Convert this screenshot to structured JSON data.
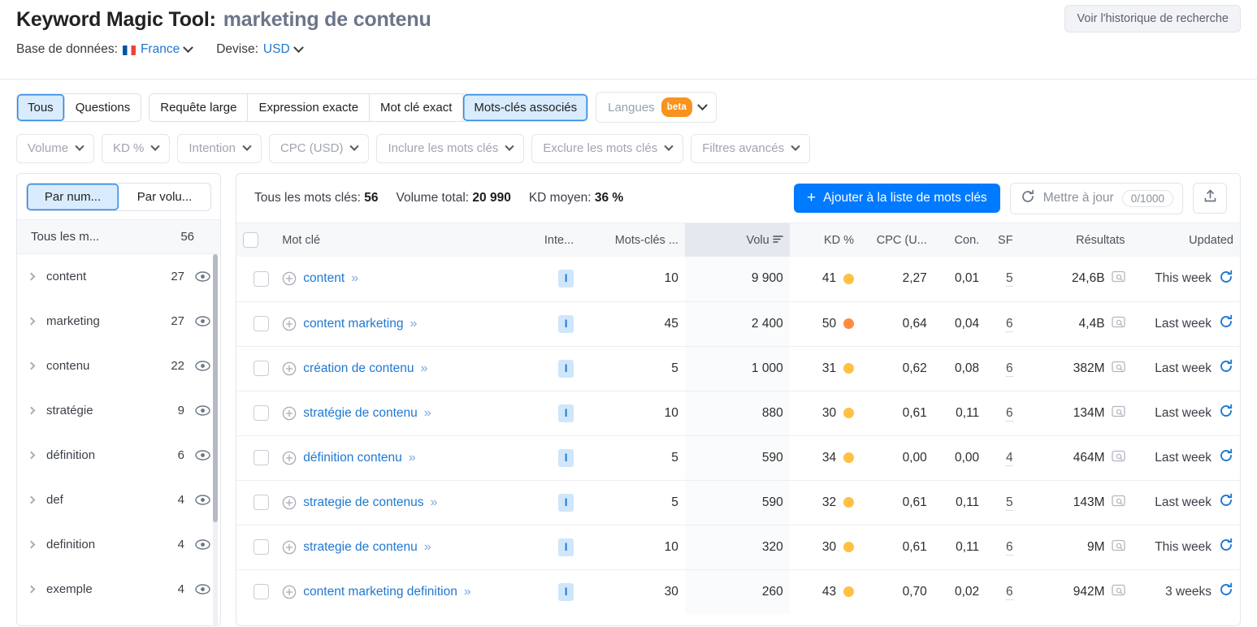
{
  "header": {
    "tool_title": "Keyword Magic Tool:",
    "query": "marketing de contenu",
    "database_label": "Base de données:",
    "database_value": "France",
    "currency_label": "Devise:",
    "currency_value": "USD",
    "history_button": "Voir l'historique de recherche"
  },
  "tabs": [
    {
      "label": "Tous",
      "active": true
    },
    {
      "label": "Questions",
      "active": false
    },
    {
      "label": "Requête large",
      "active": false
    },
    {
      "label": "Expression exacte",
      "active": false
    },
    {
      "label": "Mot clé exact",
      "active": false
    },
    {
      "label": "Mots-clés associés",
      "active": true
    }
  ],
  "languages": {
    "label": "Langues",
    "badge": "beta"
  },
  "filters": [
    "Volume",
    "KD %",
    "Intention",
    "CPC (USD)",
    "Inclure les mots clés",
    "Exclure les mots clés",
    "Filtres avancés"
  ],
  "sidebar": {
    "toggle": [
      {
        "label": "Par num...",
        "active": true
      },
      {
        "label": "Par volu...",
        "active": false
      }
    ],
    "all_label": "Tous les m...",
    "all_count": "56",
    "items": [
      {
        "label": "content",
        "count": "27"
      },
      {
        "label": "marketing",
        "count": "27"
      },
      {
        "label": "contenu",
        "count": "22"
      },
      {
        "label": "stratégie",
        "count": "9"
      },
      {
        "label": "définition",
        "count": "6"
      },
      {
        "label": "def",
        "count": "4"
      },
      {
        "label": "definition",
        "count": "4"
      },
      {
        "label": "exemple",
        "count": "4"
      }
    ]
  },
  "summary": {
    "total_keywords_label": "Tous les mots clés:",
    "total_keywords_value": "56",
    "total_volume_label": "Volume total:",
    "total_volume_value": "20 990",
    "avg_kd_label": "KD moyen:",
    "avg_kd_value": "36 %",
    "add_button": "Ajouter à la liste de mots clés",
    "update_button": "Mettre à jour",
    "update_counter": "0/1000"
  },
  "table": {
    "columns": [
      "Mot clé",
      "Inte...",
      "Mots-clés ...",
      "Volu",
      "KD %",
      "CPC (U...",
      "Con.",
      "SF",
      "Résultats",
      "Updated"
    ],
    "rows": [
      {
        "keyword": "content",
        "intent": "I",
        "related": "10",
        "volume": "9 900",
        "kd": "41",
        "kd_color": "#ffc043",
        "cpc": "2,27",
        "com": "0,01",
        "sf": "5",
        "results": "24,6B",
        "updated": "This week"
      },
      {
        "keyword": "content marketing",
        "intent": "I",
        "related": "45",
        "volume": "2 400",
        "kd": "50",
        "kd_color": "#ff8c42",
        "cpc": "0,64",
        "com": "0,04",
        "sf": "6",
        "results": "4,4B",
        "updated": "Last week"
      },
      {
        "keyword": "création de contenu",
        "intent": "I",
        "related": "5",
        "volume": "1 000",
        "kd": "31",
        "kd_color": "#ffc043",
        "cpc": "0,62",
        "com": "0,08",
        "sf": "6",
        "results": "382M",
        "updated": "Last week"
      },
      {
        "keyword": "stratégie de contenu",
        "intent": "I",
        "related": "10",
        "volume": "880",
        "kd": "30",
        "kd_color": "#ffc043",
        "cpc": "0,61",
        "com": "0,11",
        "sf": "6",
        "results": "134M",
        "updated": "Last week"
      },
      {
        "keyword": "définition contenu",
        "intent": "I",
        "related": "5",
        "volume": "590",
        "kd": "34",
        "kd_color": "#ffc043",
        "cpc": "0,00",
        "com": "0,00",
        "sf": "4",
        "results": "464M",
        "updated": "Last week"
      },
      {
        "keyword": "strategie de contenus",
        "intent": "I",
        "related": "5",
        "volume": "590",
        "kd": "32",
        "kd_color": "#ffc043",
        "cpc": "0,61",
        "com": "0,11",
        "sf": "5",
        "results": "143M",
        "updated": "Last week"
      },
      {
        "keyword": "strategie de contenu",
        "intent": "I",
        "related": "10",
        "volume": "320",
        "kd": "30",
        "kd_color": "#ffc043",
        "cpc": "0,61",
        "com": "0,11",
        "sf": "6",
        "results": "9M",
        "updated": "This week"
      },
      {
        "keyword": "content marketing definition",
        "intent": "I",
        "related": "30",
        "volume": "260",
        "kd": "43",
        "kd_color": "#ffc043",
        "cpc": "0,70",
        "com": "0,02",
        "sf": "6",
        "results": "942M",
        "updated": "3 weeks"
      }
    ]
  },
  "colors": {
    "accent_blue": "#007aff",
    "link_blue": "#1f78d1",
    "tab_active_bg": "#d9ecfd",
    "beta_orange": "#f7931e"
  }
}
